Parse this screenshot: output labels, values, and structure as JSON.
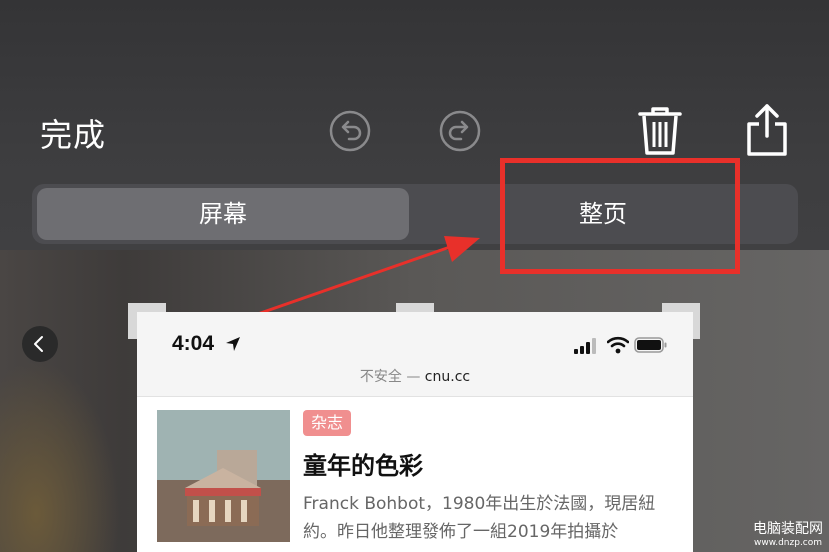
{
  "toolbar": {
    "done_label": "完成",
    "undo_icon": "undo-icon",
    "redo_icon": "redo-icon",
    "trash_icon": "trash-icon",
    "share_icon": "share-icon"
  },
  "segments": [
    {
      "label": "屏幕",
      "selected": true
    },
    {
      "label": "整页",
      "selected": false
    }
  ],
  "annotation": {
    "color": "#e8302a"
  },
  "preview": {
    "status_time": "4:04",
    "url_prefix": "不安全 — ",
    "url_domain": "cnu.cc",
    "article": {
      "tag": "杂志",
      "title": "童年的色彩",
      "excerpt": "Franck Bohbot，1980年出生於法國，現居紐約。昨日他整理發佈了一組2019年拍攝於"
    }
  },
  "watermark": {
    "line1": "电脑装配网",
    "line2": "www.dnzp.com"
  }
}
